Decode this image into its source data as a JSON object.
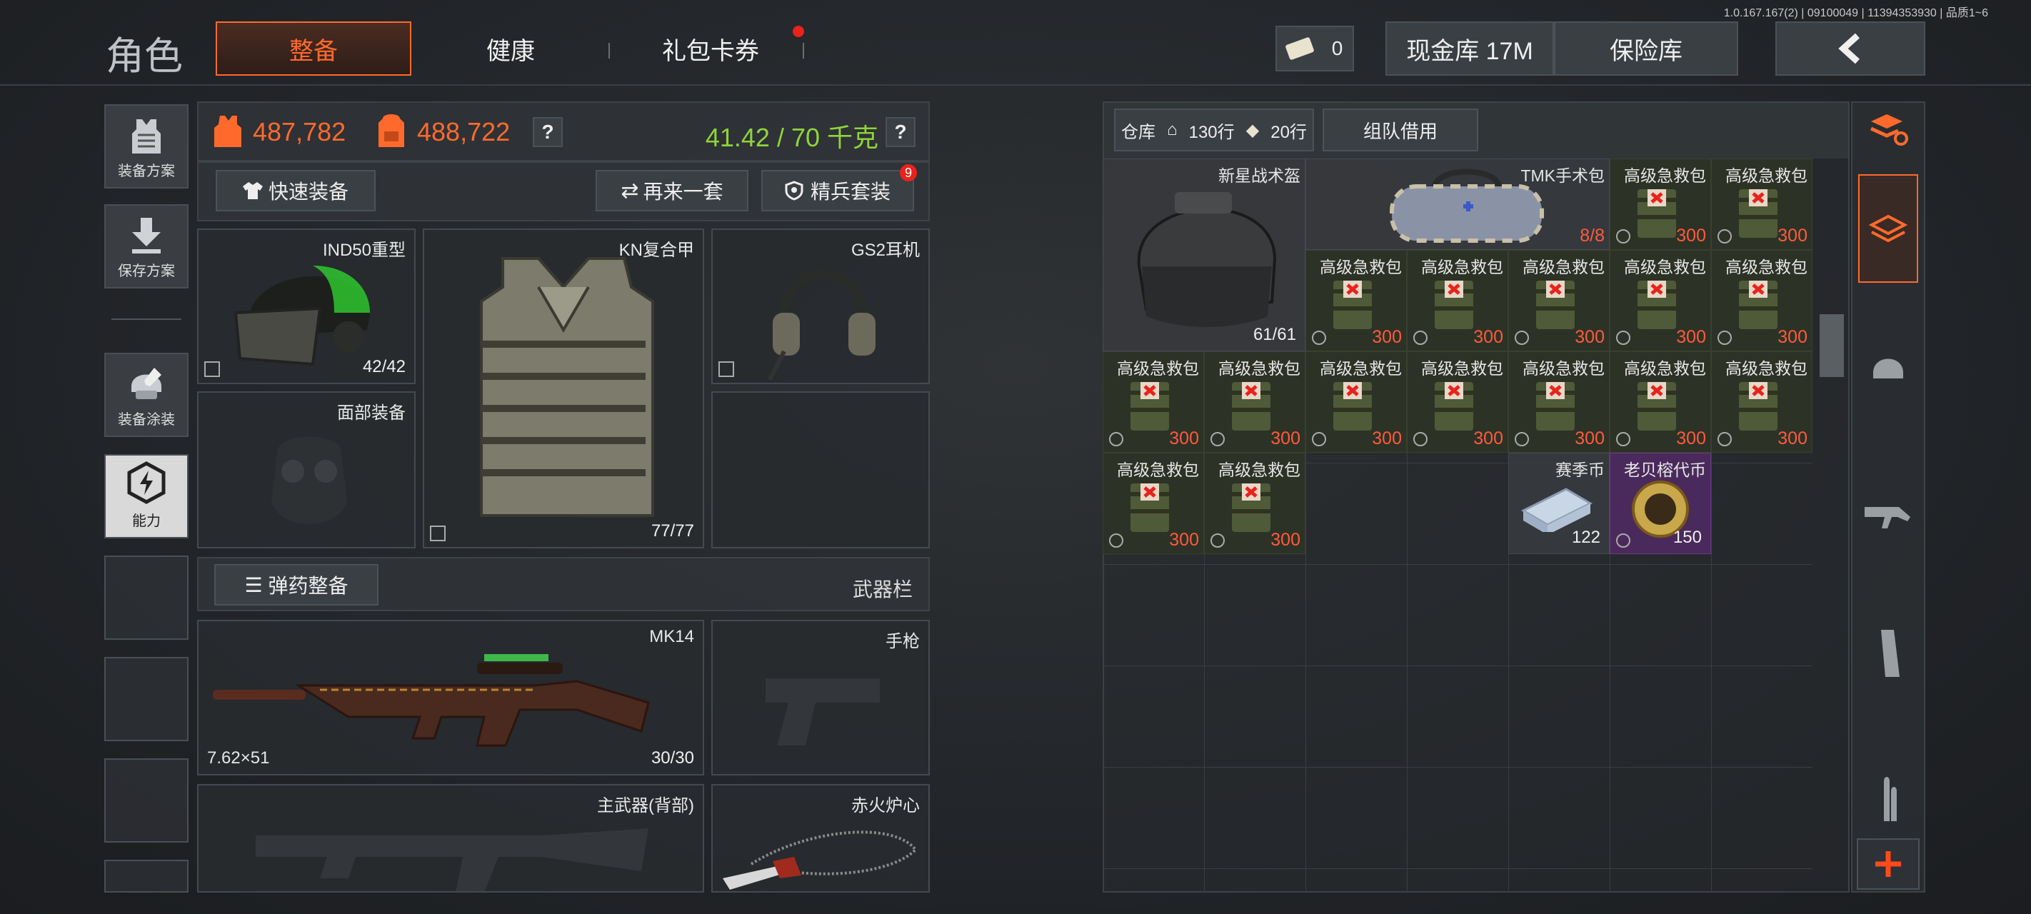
{
  "version": "1.0.167.167(2) | 09100049 | 11394353930 | 品质1~6",
  "header": {
    "title": "角色",
    "tabs": [
      {
        "label": "整备",
        "active": true
      },
      {
        "label": "健康",
        "active": false
      },
      {
        "label": "礼包卡券",
        "active": false,
        "badge": "dot"
      }
    ],
    "ticket_count": "0",
    "cash_label": "现金库 17M",
    "safe_label": "保险库",
    "back_icon": "chevron-left-icon"
  },
  "sidebar": {
    "items": [
      {
        "label": "装备方案",
        "icon": "vest-icon"
      },
      {
        "label": "保存方案",
        "icon": "download-icon"
      },
      {
        "label": "装备涂装",
        "icon": "helmet-paint-icon"
      },
      {
        "label": "能力",
        "icon": "lightning-hex-icon"
      }
    ]
  },
  "stats": {
    "value_vest": "487,782",
    "value_bag": "488,722",
    "weight": "41.42 / 70 千克",
    "help": "?"
  },
  "gear_buttons": {
    "quick_equip": "快速装备",
    "again": "再来一套",
    "elite_set": "精兵套装",
    "elite_badge": "9"
  },
  "gear": {
    "helmet": {
      "name": "IND50重型",
      "durability": "42/42"
    },
    "armor": {
      "name": "KN复合甲",
      "durability": "77/77"
    },
    "headset": {
      "name": "GS2耳机"
    },
    "face": {
      "name": "面部装备"
    }
  },
  "ammo_bar": {
    "button": "弹药整备",
    "label": "武器栏"
  },
  "weapons": {
    "primary": {
      "name": "MK14",
      "caliber": "7.62×51",
      "ammo": "30/30"
    },
    "pistol": {
      "name": "手枪"
    },
    "back": {
      "name": "主武器(背部)"
    },
    "melee": {
      "name": "赤火炉心"
    }
  },
  "stash": {
    "label": "仓库",
    "rows_home": "130行",
    "rows_ticket": "20行",
    "team_borrow": "组队借用",
    "items": {
      "helmet": {
        "name": "新星战术盔",
        "count": "61/61"
      },
      "bag": {
        "name": "TMK手术包",
        "count": "8/8"
      },
      "medkit_name": "高级急救包",
      "medkit_value": "300",
      "coin": {
        "name": "赛季币",
        "count": "122"
      },
      "token": {
        "name": "老贝榕代币",
        "count": "150"
      }
    }
  },
  "right_tabs": [
    "stack-refresh-icon",
    "layers-icon",
    "helmet-icon",
    "rifle-icon",
    "magazine-icon",
    "bullets-icon",
    "plus-icon"
  ],
  "colors": {
    "accent": "#ff6a2c",
    "weight_green": "#8fd43a",
    "value_orange": "#ff6a2c",
    "medkit_red": "#ff5a3c",
    "token_purple": "#4a2a5c"
  }
}
